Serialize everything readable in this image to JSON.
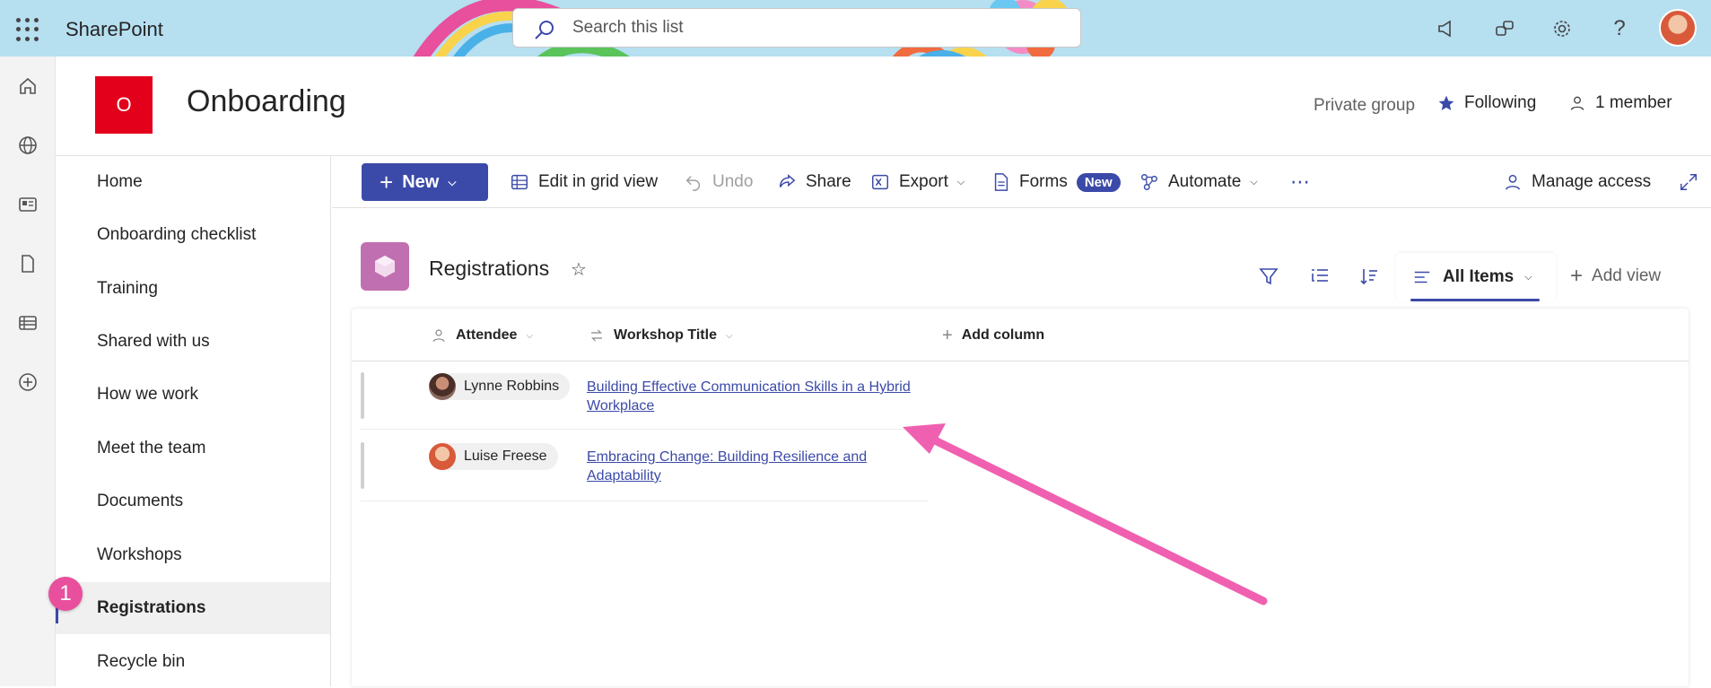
{
  "suite": {
    "brand": "SharePoint",
    "search_placeholder": "Search this list",
    "icons": [
      "waffle-icon",
      "megaphone-icon",
      "chat-icon",
      "gear-icon",
      "help-icon"
    ]
  },
  "site": {
    "logo_letter": "O",
    "title": "Onboarding",
    "privacy": "Private group",
    "following_label": "Following",
    "members_label": "1 member"
  },
  "leftnav": {
    "items": [
      {
        "label": "Home"
      },
      {
        "label": "Onboarding checklist"
      },
      {
        "label": "Training"
      },
      {
        "label": "Shared with us"
      },
      {
        "label": "How we work"
      },
      {
        "label": "Meet the team"
      },
      {
        "label": "Documents"
      },
      {
        "label": "Workshops"
      },
      {
        "label": "Registrations",
        "active": true
      },
      {
        "label": "Recycle bin"
      }
    ],
    "step_badge": "1"
  },
  "command_bar": {
    "new_label": "New",
    "grid_label": "Edit in grid view",
    "undo_label": "Undo",
    "share_label": "Share",
    "export_label": "Export",
    "forms_label": "Forms",
    "forms_badge": "New",
    "automate_label": "Automate",
    "more_label": "⋯",
    "manage_access_label": "Manage access"
  },
  "list": {
    "title": "Registrations",
    "view_name": "All Items",
    "add_view_label": "Add view",
    "columns": {
      "attendee": "Attendee",
      "workshop_title": "Workshop Title",
      "add_column": "Add column"
    },
    "rows": [
      {
        "attendee": "Lynne Robbins",
        "title": "Building Effective Communication Skills in a Hybrid Workplace"
      },
      {
        "attendee": "Luise Freese",
        "title": "Embracing Change: Building Resilience and Adaptability"
      }
    ]
  },
  "colors": {
    "accent": "#3b4aa8",
    "site_logo": "#e3001b",
    "annotation": "#f060b0",
    "suite_bg": "#b6dff0"
  }
}
